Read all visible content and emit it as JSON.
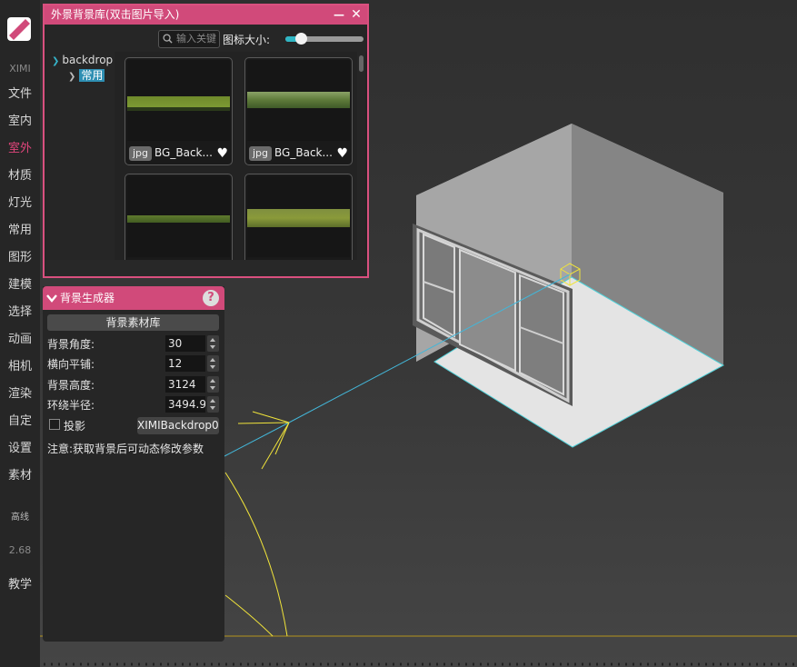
{
  "sidebar": {
    "app": "XIMI",
    "items": [
      "文件",
      "室内",
      "室外",
      "材质",
      "灯光",
      "常用",
      "图形",
      "建模",
      "选择",
      "动画",
      "相机",
      "渲染",
      "自定",
      "设置",
      "素材"
    ],
    "active": "室外",
    "extra": "高线",
    "version": "2.68",
    "tutorial": "教学"
  },
  "library": {
    "title": "外景背景库(双击图片导入)",
    "search_placeholder": "输入关键",
    "size_label": "图标大小:",
    "size_value": 0.2,
    "tree": {
      "root": "backdrop",
      "child": "常用"
    },
    "thumbnails": [
      {
        "format": "jpg",
        "name": "BG_Back..."
      },
      {
        "format": "jpg",
        "name": "BG_Back..."
      },
      {
        "format": "",
        "name": ""
      },
      {
        "format": "",
        "name": ""
      }
    ]
  },
  "generator": {
    "title": "背景生成器",
    "library_button": "背景素材库",
    "fields": [
      {
        "label": "背景角度:",
        "value": "30"
      },
      {
        "label": "横向平铺:",
        "value": "12"
      },
      {
        "label": "背景高度:",
        "value": "3124"
      },
      {
        "label": "环绕半径:",
        "value": "3494.9"
      }
    ],
    "shadow_label": "投影",
    "shadow_checked": false,
    "backdrop_name": "XIMIBackdrop0",
    "note": "注意:获取背景后可动态修改参数"
  },
  "colors": {
    "accent": "#d14a7a",
    "selection": "#2e8fb3",
    "wire": "#e6e21e"
  }
}
